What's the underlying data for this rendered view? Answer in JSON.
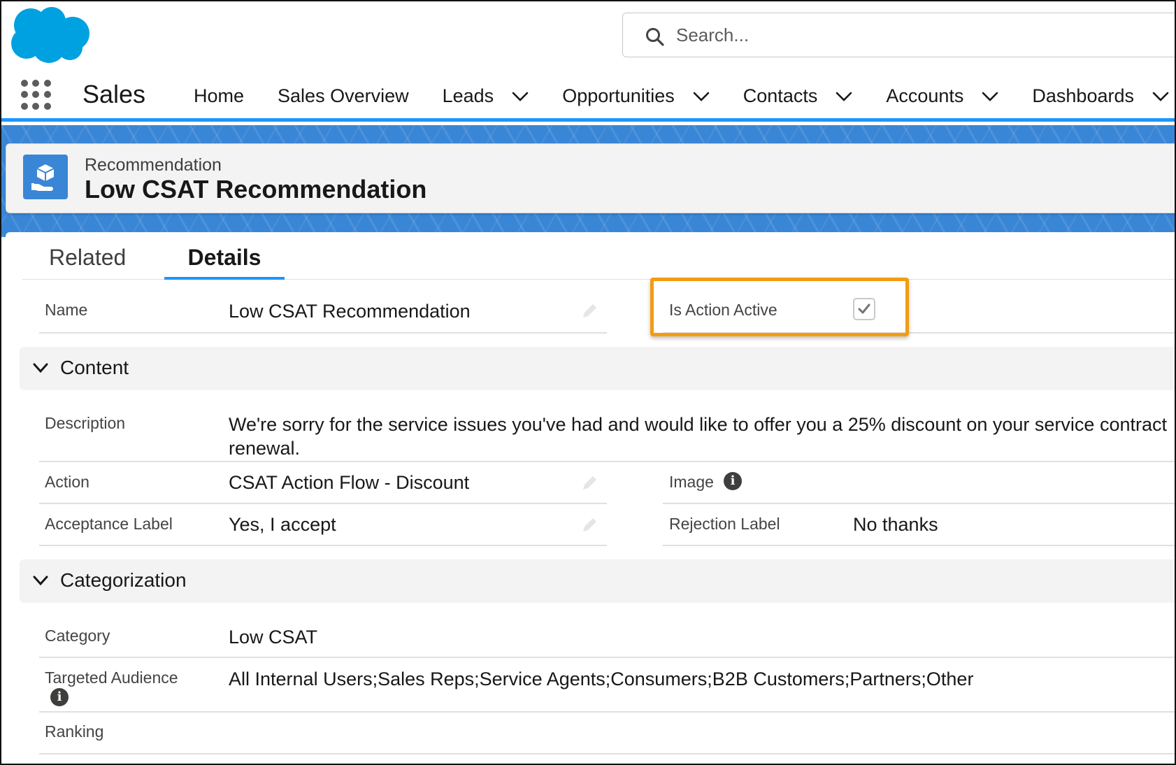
{
  "header": {
    "search_placeholder": "Search..."
  },
  "nav": {
    "app_name": "Sales",
    "items": [
      {
        "label": "Home",
        "has_menu": false
      },
      {
        "label": "Sales Overview",
        "has_menu": false
      },
      {
        "label": "Leads",
        "has_menu": true
      },
      {
        "label": "Opportunities",
        "has_menu": true
      },
      {
        "label": "Contacts",
        "has_menu": true
      },
      {
        "label": "Accounts",
        "has_menu": true
      },
      {
        "label": "Dashboards",
        "has_menu": true
      }
    ]
  },
  "record": {
    "type": "Recommendation",
    "title": "Low CSAT Recommendation"
  },
  "tabs": {
    "related": "Related",
    "details": "Details",
    "active": "Details"
  },
  "fields": {
    "name_label": "Name",
    "name_value": "Low CSAT Recommendation",
    "is_action_active_label": "Is Action Active",
    "is_action_active_checked": true
  },
  "content_section": {
    "title": "Content",
    "description_label": "Description",
    "description_value": "We're sorry for the service issues you've had and would like to offer you a 25% discount on your service contract renewal.",
    "action_label": "Action",
    "action_value": "CSAT Action Flow - Discount",
    "image_label": "Image",
    "acceptance_label_label": "Acceptance Label",
    "acceptance_label_value": "Yes, I accept",
    "rejection_label_label": "Rejection Label",
    "rejection_label_value": "No thanks"
  },
  "categorization_section": {
    "title": "Categorization",
    "category_label": "Category",
    "category_value": "Low CSAT",
    "targeted_audience_label": "Targeted Audience",
    "targeted_audience_value": "All Internal Users;Sales Reps;Service Agents;Consumers;B2B Customers;Partners;Other",
    "ranking_label": "Ranking"
  },
  "colors": {
    "brand_blue": "#1b96ff",
    "band_blue": "#3a86d6",
    "logo_blue": "#00a1e0",
    "highlight_orange": "#f39c12"
  }
}
